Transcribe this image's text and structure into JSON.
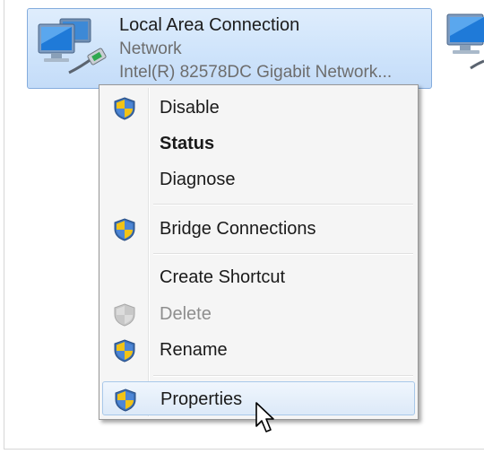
{
  "window": {
    "frame_color": "#d6d6d6"
  },
  "connection": {
    "name": "Local Area Connection",
    "network": "Network",
    "adapter": "Intel(R) 82578DC Gigabit Network...",
    "icon": "network-adapter-icon",
    "selected": true
  },
  "neighbor_connection": {
    "icon": "network-adapter-icon"
  },
  "context_menu": {
    "items": [
      {
        "label": "Disable",
        "shield": true,
        "bold": false,
        "disabled": false
      },
      {
        "label": "Status",
        "shield": false,
        "bold": true,
        "disabled": false
      },
      {
        "label": "Diagnose",
        "shield": false,
        "bold": false,
        "disabled": false
      },
      {
        "label": "Bridge Connections",
        "shield": true,
        "bold": false,
        "disabled": false
      },
      {
        "label": "Create Shortcut",
        "shield": false,
        "bold": false,
        "disabled": false
      },
      {
        "label": "Delete",
        "shield": true,
        "bold": false,
        "disabled": true
      },
      {
        "label": "Rename",
        "shield": true,
        "bold": false,
        "disabled": false
      },
      {
        "label": "Properties",
        "shield": true,
        "bold": false,
        "disabled": false,
        "hovered": true
      }
    ]
  },
  "colors": {
    "selection": "#cfe4fb",
    "menu_background": "#f5f5f5",
    "hover_border": "#a8c8e9",
    "disabled_text": "#8e8e8e"
  }
}
